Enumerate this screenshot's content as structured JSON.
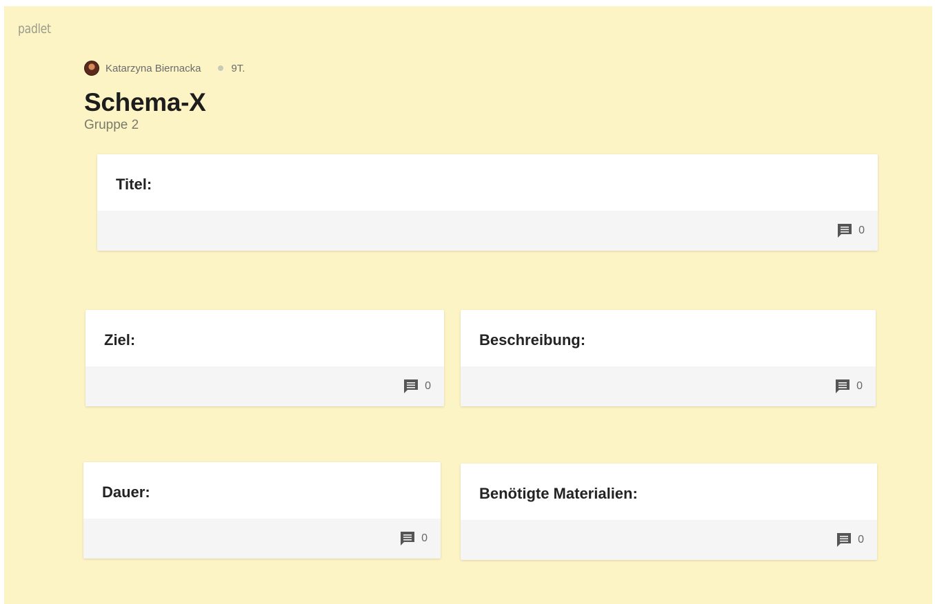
{
  "brand": "padlet",
  "author": {
    "name": "Katarzyna Biernacka",
    "time": "9T."
  },
  "board": {
    "title": "Schema-X",
    "subtitle": "Gruppe 2"
  },
  "posts": [
    {
      "title": "Titel:",
      "comments": "0"
    },
    {
      "title": "Ziel:",
      "comments": "0"
    },
    {
      "title": "Beschreibung:",
      "comments": "0"
    },
    {
      "title": "Dauer:",
      "comments": "0"
    },
    {
      "title": "Benötigte Materialien:",
      "comments": "0"
    }
  ],
  "icons": {
    "comment": "comment-icon",
    "avatar": "avatar"
  },
  "colors": {
    "background": "#fdf4c5",
    "card": "#ffffff",
    "card_footer": "#f5f5f5",
    "icon": "#555555"
  }
}
